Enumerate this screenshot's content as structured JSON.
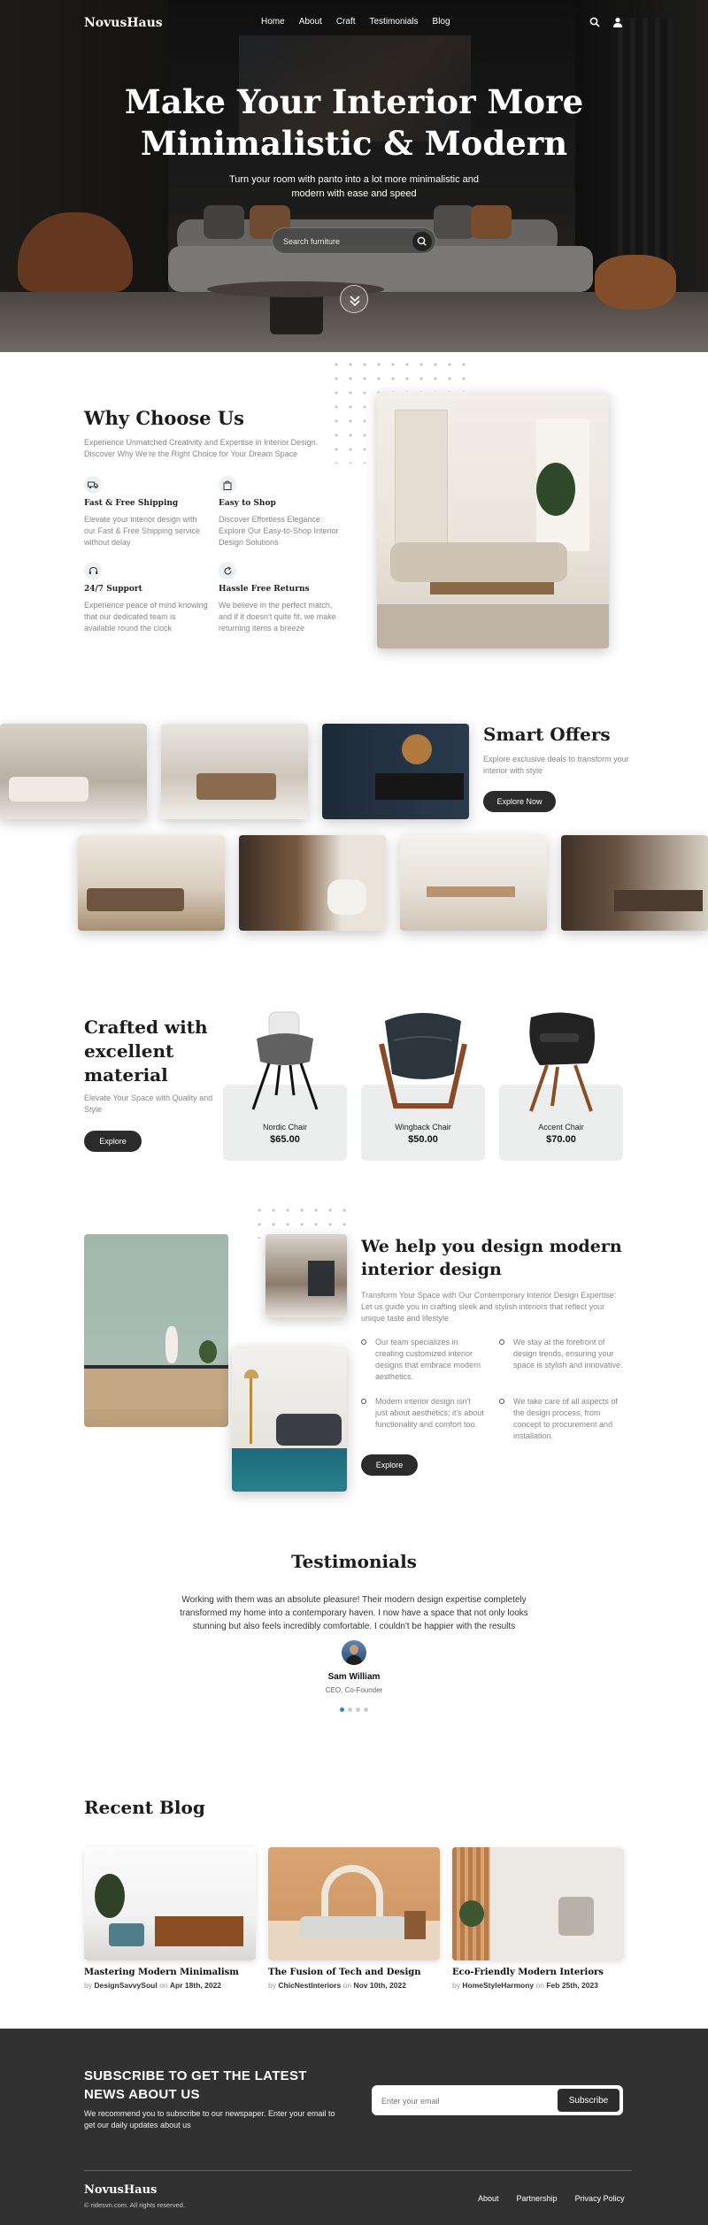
{
  "nav": {
    "logo": "NovusHaus",
    "links": [
      "Home",
      "About",
      "Craft",
      "Testimonials",
      "Blog"
    ]
  },
  "hero": {
    "title": "Make Your Interior More Minimalistic & Modern",
    "subtitle": "Turn your room with panto into a lot more minimalistic and modern with ease and speed",
    "search_placeholder": "Search furniture"
  },
  "why": {
    "title": "Why Choose Us",
    "intro": "Experience Unmatched Creativity and Expertise in Interior Design. Discover Why We're the Right Choice for Your Dream Space",
    "features": [
      {
        "icon": "truck-icon",
        "title": "Fast & Free Shipping",
        "text": "Elevate your interior design with our Fast & Free Shipping service without delay"
      },
      {
        "icon": "bag-icon",
        "title": "Easy to Shop",
        "text": "Discover Effortless Elegance: Explore Our Easy-to-Shop Interior Design Solutions"
      },
      {
        "icon": "headset-icon",
        "title": "24/7 Support",
        "text": "Experience peace of mind knowing that our dedicated team is available round the clock"
      },
      {
        "icon": "refresh-icon",
        "title": "Hassle Free Returns",
        "text": "We believe in the perfect match, and if it doesn't quite fit, we make returning items a breeze"
      }
    ]
  },
  "offers": {
    "title": "Smart Offers",
    "text": "Explore exclusive deals to transform your interior with style",
    "button": "Explore Now"
  },
  "crafted": {
    "title": "Crafted with excellent material",
    "text": "Elevate Your Space with Quality and Style",
    "button": "Explore",
    "products": [
      {
        "name": "Nordic Chair",
        "price": "$65.00"
      },
      {
        "name": "Wingback Chair",
        "price": "$50.00"
      },
      {
        "name": "Accent Chair",
        "price": "$70.00"
      }
    ]
  },
  "design": {
    "title": "We help you design modern interior design",
    "text": "Transform Your Space with Our Contemporary Interior Design Expertise: Let us guide you in crafting sleek and stylish interiors that reflect your unique taste and lifestyle",
    "points": [
      "Our team specializes in creating customized interior designs that embrace modern aesthetics.",
      "We stay at the forefront of design trends, ensuring your space is stylish and innovative.",
      "Modern interior design isn't just about aesthetics; it's about functionality and comfort too.",
      "We take care of all aspects of the design process, from concept to procurement and installation."
    ],
    "button": "Explore"
  },
  "testimonials": {
    "title": "Testimonials",
    "quote": "Working with them was an absolute pleasure! Their modern design expertise completely transformed my home into a contemporary haven. I now have a space that not only looks stunning but also feels incredibly comfortable. I couldn't be happier with the results",
    "name": "Sam William",
    "role": "CEO, Co-Founder"
  },
  "blog": {
    "title": "Recent Blog",
    "by": "by",
    "on": "on",
    "posts": [
      {
        "title": "Mastering Modern Minimalism",
        "author": "DesignSavvySoul",
        "date": "Apr 18th, 2022"
      },
      {
        "title": "The Fusion of Tech and Design",
        "author": "ChicNestInteriors",
        "date": "Nov 10th, 2022"
      },
      {
        "title": "Eco-Friendly Modern Interiors",
        "author": "HomeStyleHarmony",
        "date": "Feb 25th, 2023"
      }
    ]
  },
  "subscribe": {
    "title": "SUBSCRIBE TO GET THE LATEST NEWS ABOUT US",
    "text": "We recommend you to subscribe to our newspaper. Enter your email to get our daily updates about us",
    "placeholder": "Enter your email",
    "button": "Subscribe"
  },
  "footer": {
    "logo": "NovusHaus",
    "copyright": "© ridesvn.com. All rights reserved.",
    "links": [
      "About",
      "Partnership",
      "Privacy Policy"
    ]
  },
  "colors": {
    "accent_dark": "#2b2b2b",
    "footer_bg": "#313131",
    "card_bg": "#eceeee",
    "active_dot": "#3b82c4"
  }
}
